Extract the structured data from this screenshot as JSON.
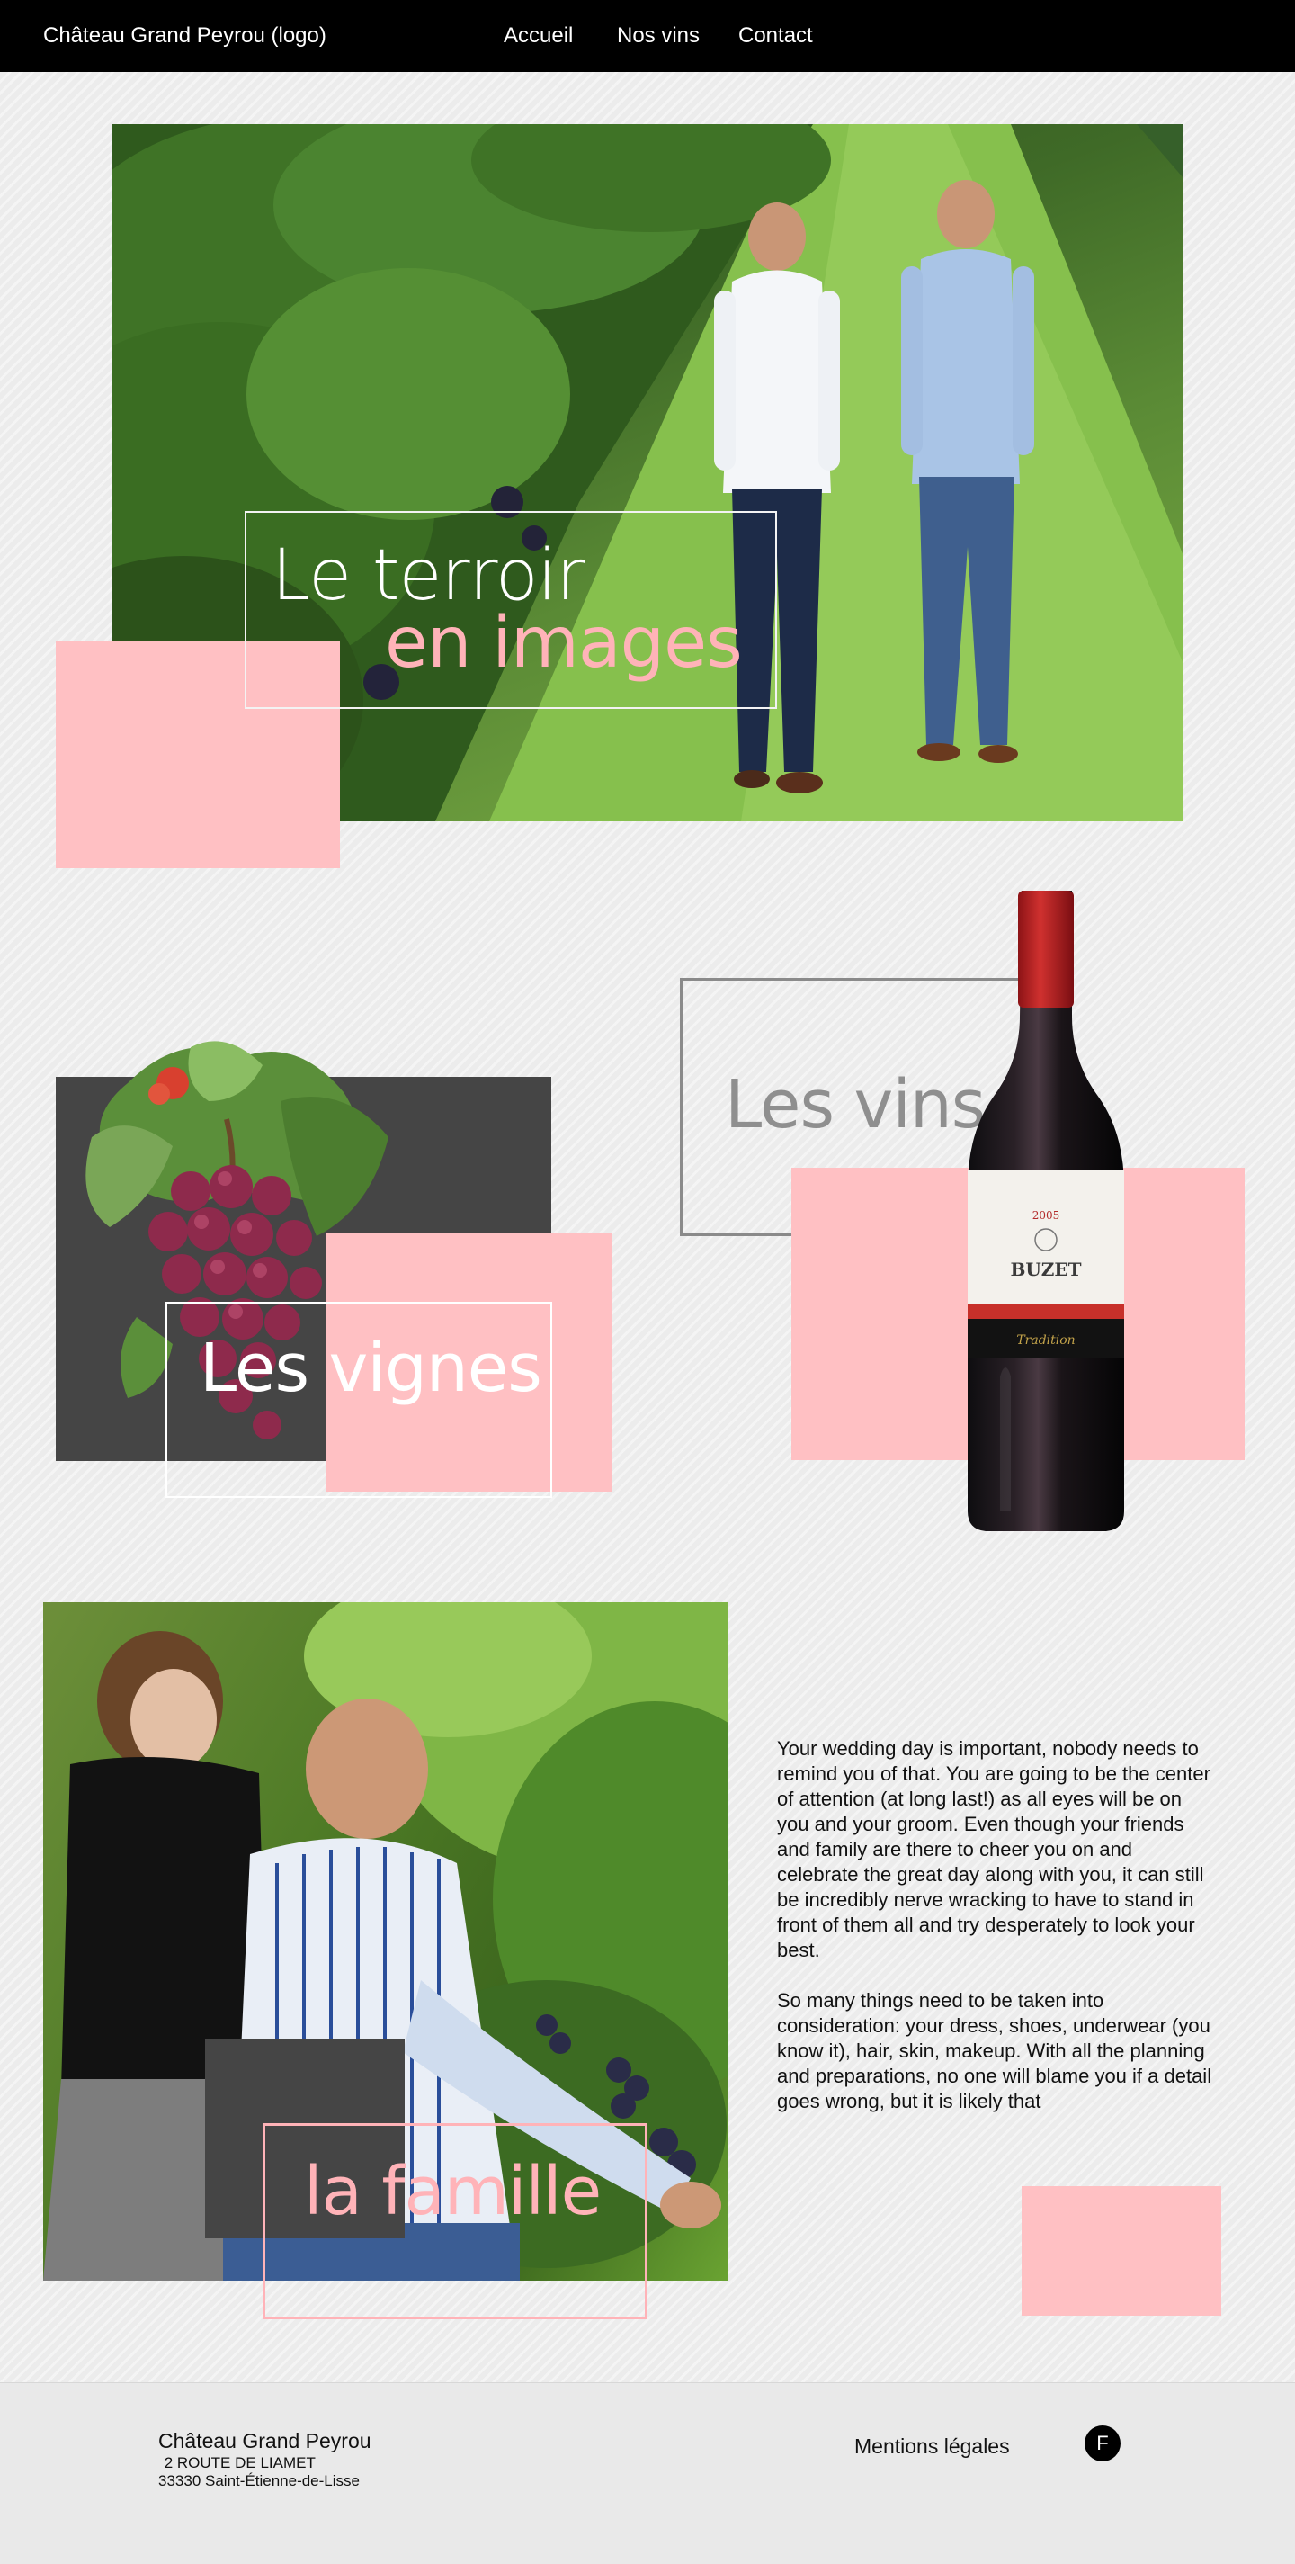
{
  "header": {
    "logo": "Château Grand Peyrou (logo)",
    "nav": {
      "home": "Accueil",
      "wines": "Nos vins",
      "contact": "Contact"
    }
  },
  "hero": {
    "title_line1": "Le terroir",
    "title_line2": "en images"
  },
  "vignes": {
    "title": "Les vignes"
  },
  "vins": {
    "title": "Les vins",
    "bottle_label": {
      "year": "2005",
      "brand": "BUZET",
      "cuvee": "Tradition"
    }
  },
  "famille": {
    "title": "la famille",
    "paragraph1": "Your wedding day is important, nobody needs to remind you of that. You are going to be the center of attention (at long last!) as all eyes will be on you and your groom. Even though your friends and family are there to cheer you on and celebrate the great day along with you, it can still be incredibly nerve wracking to have to stand in front of them all and try desperately to look your best.",
    "paragraph2": "So many things need to be taken into consideration: your dress, shoes, underwear (you know it), hair, skin, makeup. With all the planning and preparations, no one will blame you if a detail goes wrong, but it is likely that"
  },
  "footer": {
    "name": "Château Grand Peyrou",
    "street": " 2 ROUTE DE LIAMET",
    "city": "33330 Saint-Étienne-de-Lisse",
    "legal": "Mentions légales",
    "facebook": "F"
  },
  "colors": {
    "accent_pink": "#ffc0c3",
    "title_pink": "#ffb3b8",
    "dark_block": "#454545",
    "nav_bg": "#000000"
  },
  "icons": {
    "facebook": "facebook-icon"
  }
}
